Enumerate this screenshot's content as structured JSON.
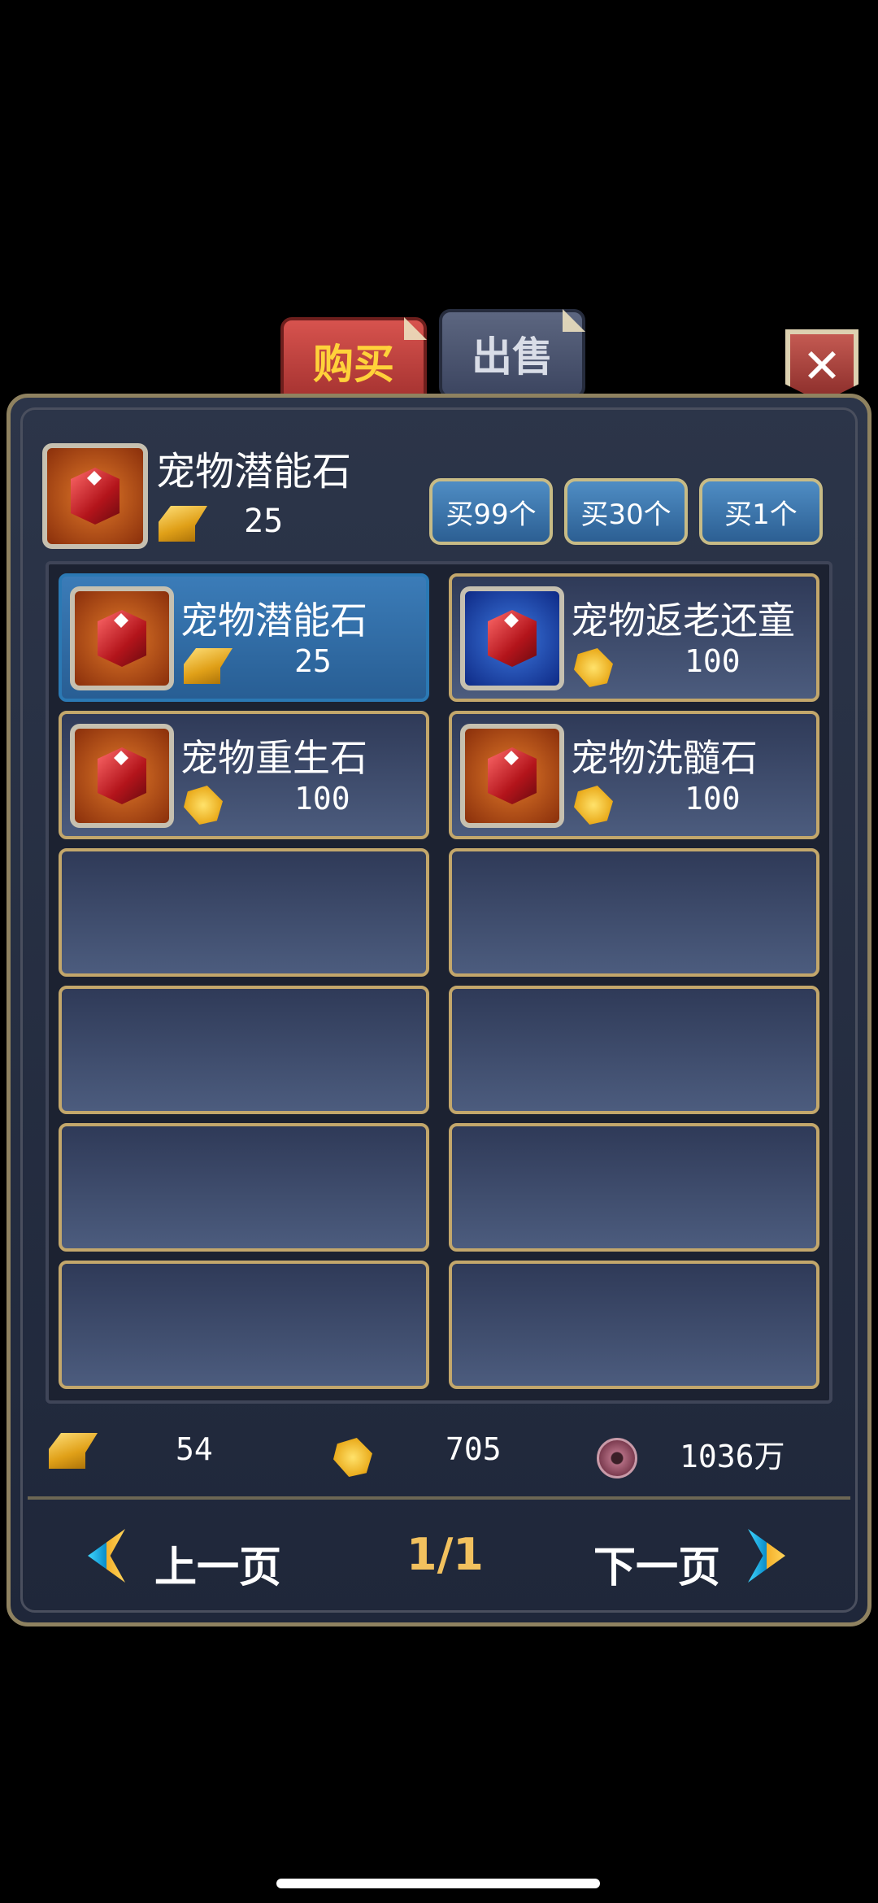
{
  "tabs": {
    "buy": "购买",
    "sell": "出售"
  },
  "close_label": "✕",
  "selected_item": {
    "name": "宠物潜能石",
    "price": "25",
    "currency": "gold-ingot"
  },
  "buy_buttons": [
    "买99个",
    "买30个",
    "买1个"
  ],
  "items": [
    {
      "name": "宠物潜能石",
      "price": "25",
      "currency": "gold-ingot",
      "icon": "red-gem",
      "selected": true
    },
    {
      "name": "宠物返老还童",
      "price": "100",
      "currency": "gold-leaf",
      "icon": "red-gem-blue-bg",
      "selected": false
    },
    {
      "name": "宠物重生石",
      "price": "100",
      "currency": "gold-leaf",
      "icon": "red-gem",
      "selected": false
    },
    {
      "name": "宠物洗髓石",
      "price": "100",
      "currency": "gold-leaf",
      "icon": "red-gem",
      "selected": false
    }
  ],
  "currencies": {
    "gold": "54",
    "leaf": "705",
    "coin": "1036万"
  },
  "pagination": {
    "prev": "上一页",
    "page": "1/1",
    "next": "下一页"
  }
}
